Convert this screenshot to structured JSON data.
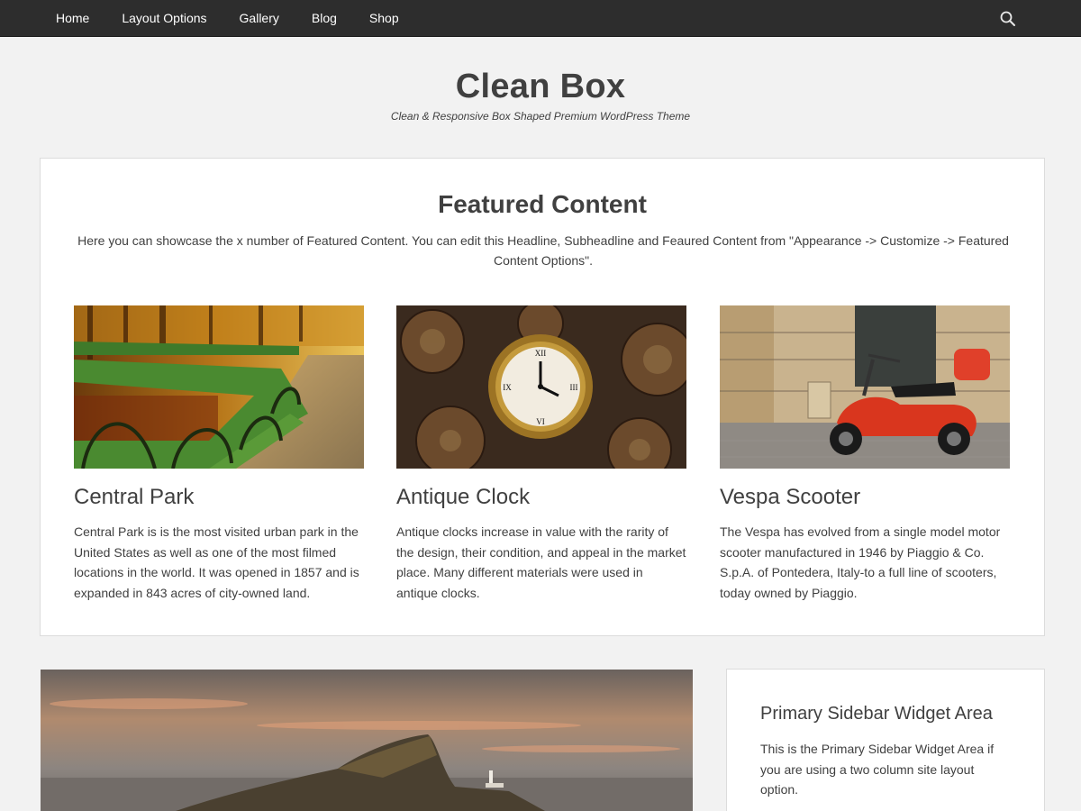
{
  "nav": {
    "items": [
      {
        "label": "Home"
      },
      {
        "label": "Layout Options"
      },
      {
        "label": "Gallery"
      },
      {
        "label": "Blog"
      },
      {
        "label": "Shop"
      }
    ],
    "search_icon": "search-icon",
    "background": "#2d2d2d"
  },
  "site": {
    "title": "Clean Box",
    "description": "Clean & Responsive Box Shaped Premium WordPress Theme"
  },
  "featured": {
    "heading": "Featured Content",
    "subheading": "Here you can showcase the x number of Featured Content. You can edit this Headline, Subheadline and Feaured Content from \"Appearance -> Customize -> Featured Content Options\".",
    "items": [
      {
        "title": "Central Park",
        "text": "Central Park is is the most visited urban park in the United States as well as one of the most filmed locations in the world. It was opened in 1857 and is expanded in 843 acres of city-owned land."
      },
      {
        "title": "Antique Clock",
        "text": "Antique clocks increase in value with the rarity of the design, their condition, and appeal in the market place. Many different materials were used in antique clocks."
      },
      {
        "title": "Vespa Scooter",
        "text": "The Vespa has evolved from a single model motor scooter manufactured in 1946 by Piaggio & Co. S.p.A. of Pontedera, Italy-to a full line of scooters, today owned by Piaggio."
      }
    ]
  },
  "sidebar": {
    "title": "Primary Sidebar Widget Area",
    "text": "This is the Primary Sidebar Widget Area if you are using a two column site layout option."
  },
  "colors": {
    "page_bg": "#f2f2f2",
    "text": "#404040",
    "box_bg": "#ffffff"
  }
}
